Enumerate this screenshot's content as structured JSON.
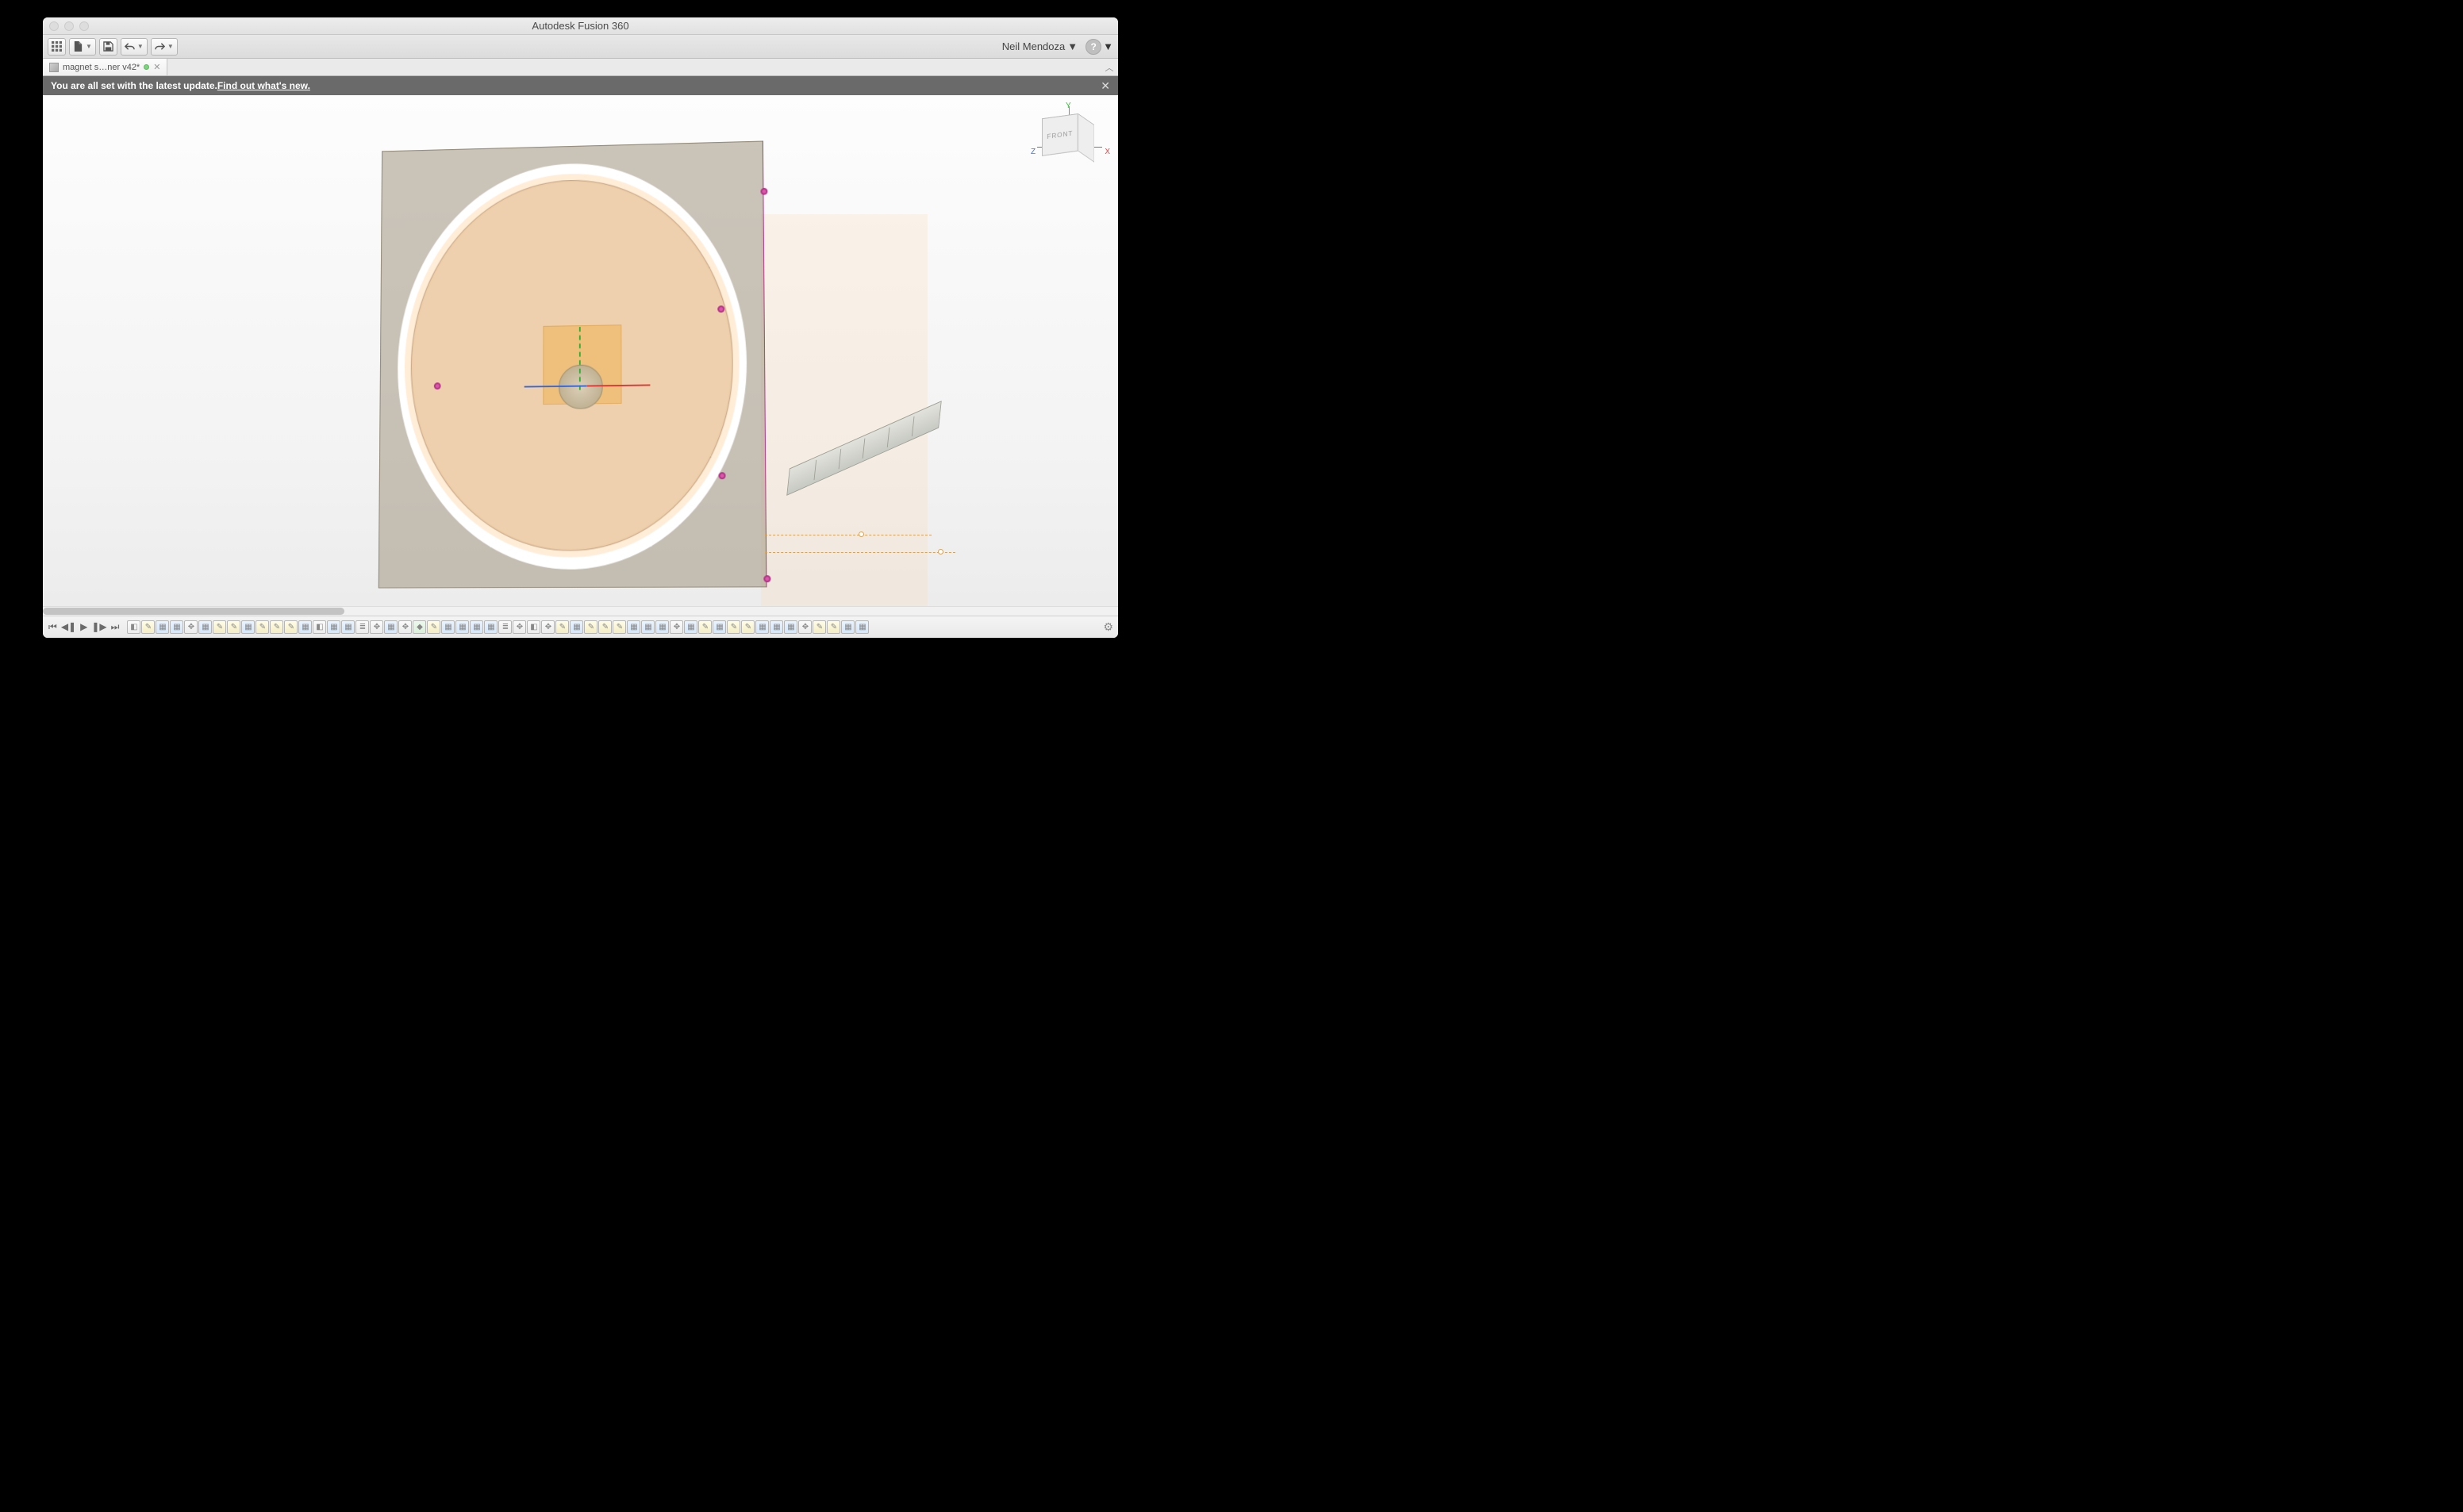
{
  "window": {
    "title": "Autodesk Fusion 360"
  },
  "user": {
    "name": "Neil Mendoza"
  },
  "tab": {
    "label": "magnet s…ner v42*"
  },
  "banner": {
    "text": "You are all set with the latest update. ",
    "link": "Find out what's new."
  },
  "viewcube": {
    "front": "FRONT",
    "axis_x": "X",
    "axis_y": "Y",
    "axis_z": "Z"
  },
  "toolbar": {
    "grid": "grid-view",
    "file": "file",
    "save": "save",
    "undo": "undo",
    "redo": "redo",
    "help": "?"
  },
  "timeline_nodes": [
    "cube",
    "sk",
    "bl",
    "bl",
    "move",
    "bl",
    "sk",
    "sk",
    "bl",
    "sk",
    "sk",
    "sk",
    "bl",
    "cube",
    "bl",
    "bl",
    "stack",
    "move",
    "bl",
    "move",
    "gr",
    "sk",
    "bl",
    "bl",
    "bl",
    "bl",
    "stack",
    "move",
    "cube",
    "move",
    "sk",
    "bl",
    "sk",
    "sk",
    "sk",
    "bl",
    "bl",
    "bl",
    "move",
    "bl",
    "sk",
    "bl",
    "sk",
    "sk",
    "bl",
    "bl",
    "bl",
    "move",
    "sk",
    "sk",
    "bl",
    "bl"
  ]
}
